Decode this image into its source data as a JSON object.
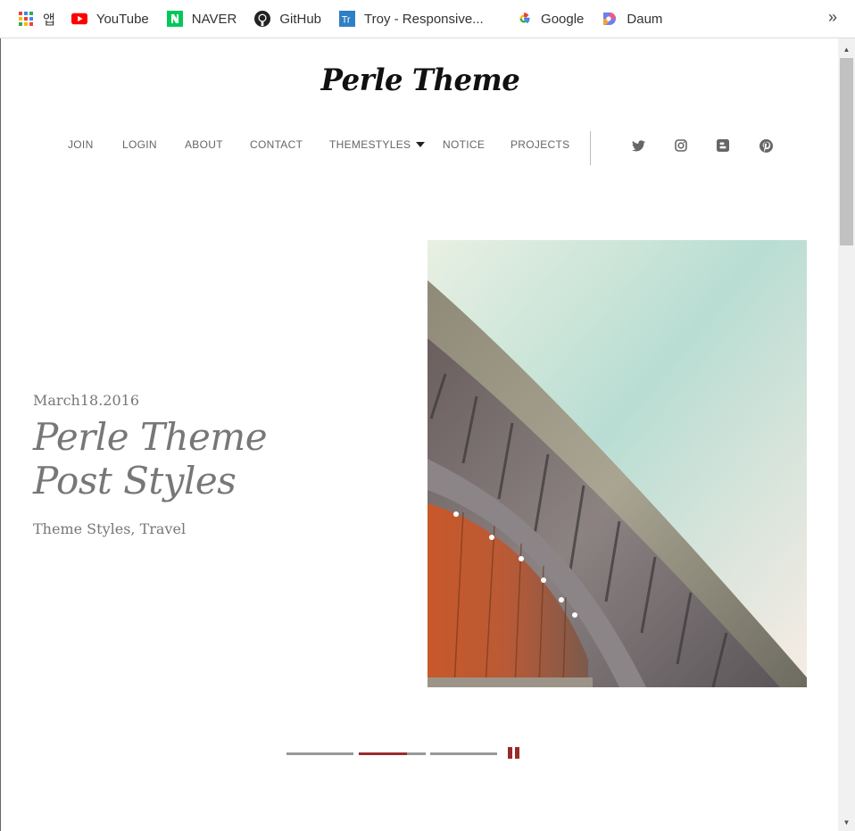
{
  "bookmarks": {
    "apps_label": "앱",
    "items": [
      {
        "label": "YouTube"
      },
      {
        "label": "NAVER"
      },
      {
        "label": "GitHub"
      },
      {
        "label": "Troy - Responsive..."
      },
      {
        "label": "Google"
      },
      {
        "label": "Daum"
      }
    ],
    "overflow": "»"
  },
  "site": {
    "title": "Perle Theme"
  },
  "nav": {
    "items": [
      {
        "label": "JOIN"
      },
      {
        "label": "LOGIN"
      },
      {
        "label": "ABOUT"
      },
      {
        "label": "CONTACT"
      },
      {
        "label": "THEMESTYLES"
      },
      {
        "label": "NOTICE"
      },
      {
        "label": "PROJECTS"
      }
    ],
    "social": [
      "twitter-icon",
      "instagram-icon",
      "blogger-icon",
      "pinterest-icon"
    ]
  },
  "hero": {
    "date": "March18.2016",
    "title_line1": "Perle Theme",
    "title_line2": "Post Styles",
    "categories": "Theme Styles, Travel"
  },
  "slider": {
    "slides": 3,
    "active_index": 1,
    "active_progress": 0.72,
    "accent": "#9b2a2a",
    "track": "#999999"
  },
  "colors": {
    "youtube": "#ff0000",
    "naver": "#03c75a",
    "troy": "#2f7fc4"
  }
}
